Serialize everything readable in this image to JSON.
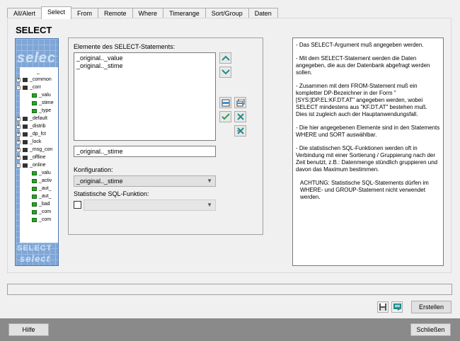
{
  "tabs": [
    {
      "label": "All/Alert"
    },
    {
      "label": "Select"
    },
    {
      "label": "From"
    },
    {
      "label": "Remote"
    },
    {
      "label": "Where"
    },
    {
      "label": "Timerange"
    },
    {
      "label": "Sort/Group"
    },
    {
      "label": "Daten"
    }
  ],
  "panel": {
    "heading": "SELECT"
  },
  "tree": {
    "watermark_top": "selec",
    "watermark_mid": "SELECT",
    "watermark_bottom": "select",
    "items": [
      {
        "label": "_",
        "kind": "leaf"
      },
      {
        "label": "_common",
        "kind": "folder"
      },
      {
        "label": "_corr",
        "kind": "folder"
      },
      {
        "label": "_valu",
        "kind": "dp"
      },
      {
        "label": "_stime",
        "kind": "dp"
      },
      {
        "label": "_type",
        "kind": "dp"
      },
      {
        "label": "_default",
        "kind": "folder"
      },
      {
        "label": "_distrib",
        "kind": "folder"
      },
      {
        "label": "_dp_fct",
        "kind": "folder"
      },
      {
        "label": "_lock",
        "kind": "folder"
      },
      {
        "label": "_msg_con",
        "kind": "folder"
      },
      {
        "label": "_offline",
        "kind": "folder"
      },
      {
        "label": "_online",
        "kind": "folder"
      },
      {
        "label": "_valu",
        "kind": "dp"
      },
      {
        "label": "_activ",
        "kind": "dp"
      },
      {
        "label": "_aut_",
        "kind": "dp"
      },
      {
        "label": "_aut_",
        "kind": "dp"
      },
      {
        "label": "_bad",
        "kind": "dp"
      },
      {
        "label": "_com",
        "kind": "dp"
      },
      {
        "label": "_com",
        "kind": "dp"
      }
    ]
  },
  "elements": {
    "label": "Elemente des SELECT-Statements:",
    "items": [
      "_original.._value",
      "_original.._stime"
    ],
    "current": "_original.._stime"
  },
  "config": {
    "label": "Konfiguration:",
    "value": "_original.._stime"
  },
  "sqlfunc": {
    "label": "Statistische SQL-Funktion:",
    "value": ""
  },
  "help": [
    "- Das SELECT-Argument muß angegeben werden.",
    "- Mit dem SELECT-Statement werden die Daten angegeben, die aus der Datenbank abgefragt werden sollen.",
    "- Zusammen mit dem FROM-Statement muß ein kompletter DP-Bezeichner in der Form \"[SYS:]DP.EL:KF.DT.AT\" angegeben werden, wobei SELECT mindestens aus \"KF.DT.AT\" bestehen muß. Dies ist zugleich auch der Hauptanwendungsfall.",
    "- Die hier angegebenen Elemente sind in den Statements WHERE und SORT auswählbar.",
    "- Die statistischen SQL-Funktionen werden oft in Verbindung mit einer Sortierung / Gruppierung nach der Zeit benutzt, z.B.: Datenmenge stündlich gruppieren und davon das Maximum bestimmen.",
    "ACHTUNG: Statistische SQL-Statements dürfen im WHERE- und GROUP-Statement nicht verwendet werden."
  ],
  "buttons": {
    "create": "Erstellen",
    "help": "Hilfe",
    "close": "Schließen"
  },
  "colors": {
    "accent": "#3d8fd1",
    "tree_bg": "#7fa6d6",
    "ok_green": "#2e9e4a",
    "teal": "#1e8c8c"
  }
}
